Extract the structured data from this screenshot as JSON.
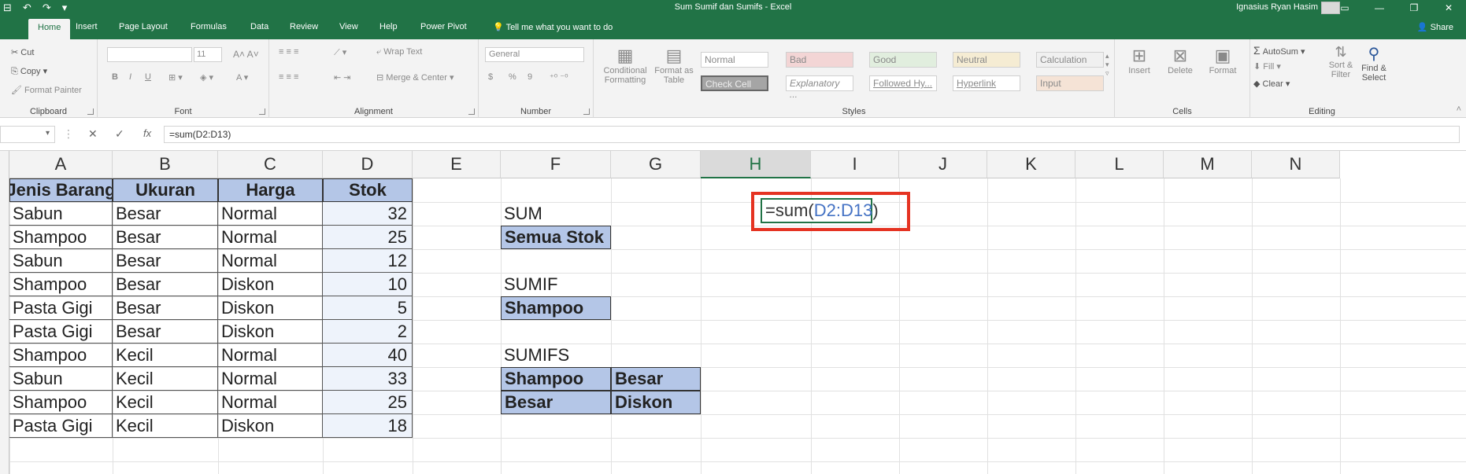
{
  "window": {
    "title": "Sum Sumif dan Sumifs  -  Excel",
    "user": "Ignasius Ryan Hasim",
    "controls": [
      "▭",
      "—",
      "❐",
      "✕"
    ]
  },
  "qat": {
    "save": "⊟",
    "undo": "↶",
    "redo": "↷",
    "more": "▾"
  },
  "tabs": [
    "Home",
    "Insert",
    "Page Layout",
    "Formulas",
    "Data",
    "Review",
    "View",
    "Help",
    "Power Pivot"
  ],
  "tell_me": "Tell me what you want to do",
  "share": "Share",
  "ribbon": {
    "clipboard": {
      "label": "Clipboard",
      "cut": "Cut",
      "copy": "Copy",
      "format_painter": "Format Painter"
    },
    "font": {
      "label": "Font",
      "size": "11",
      "bold": "B",
      "italic": "I",
      "underline": "U"
    },
    "alignment": {
      "label": "Alignment",
      "wrap_text": "Wrap Text",
      "merge_center": "Merge & Center"
    },
    "number": {
      "label": "Number",
      "format": "General",
      "currency": "$",
      "percent": "%",
      "comma": "9"
    },
    "styles": {
      "label": "Styles",
      "conditional": "Conditional",
      "conditional_sub": "Formatting",
      "format_as": "Format as",
      "format_as_sub": "Table",
      "gallery": [
        "Normal",
        "Bad",
        "Good",
        "Neutral",
        "Calculation",
        "Check Cell",
        "Explanatory ...",
        "Followed Hy...",
        "Hyperlink",
        "Input"
      ]
    },
    "cells": {
      "label": "Cells",
      "insert": "Insert",
      "delete": "Delete",
      "format": "Format"
    },
    "editing": {
      "label": "Editing",
      "autosum": "AutoSum",
      "fill": "Fill",
      "clear": "Clear",
      "sort": "Sort &",
      "sort_sub": "Filter",
      "find": "Find &",
      "find_sub": "Select"
    }
  },
  "formula_bar": {
    "cancel": "✕",
    "enter": "✓",
    "fx": "fx",
    "value": "=sum(D2:D13)"
  },
  "columns": [
    "A",
    "B",
    "C",
    "D",
    "E",
    "F",
    "G",
    "H",
    "I",
    "J",
    "K",
    "L",
    "M",
    "N"
  ],
  "active_column": "H",
  "table": {
    "headers": [
      "Jenis Barang",
      "Ukuran",
      "Harga",
      "Stok"
    ],
    "rows": [
      [
        "Sabun",
        "Besar",
        "Normal",
        "32"
      ],
      [
        "Shampoo",
        "Besar",
        "Normal",
        "25"
      ],
      [
        "Sabun",
        "Besar",
        "Normal",
        "12"
      ],
      [
        "Shampoo",
        "Besar",
        "Diskon",
        "10"
      ],
      [
        "Pasta Gigi",
        "Besar",
        "Diskon",
        "5"
      ],
      [
        "Pasta Gigi",
        "Besar",
        "Diskon",
        "2"
      ],
      [
        "Shampoo",
        "Kecil",
        "Normal",
        "40"
      ],
      [
        "Sabun",
        "Kecil",
        "Normal",
        "33"
      ],
      [
        "Shampoo",
        "Kecil",
        "Normal",
        "25"
      ],
      [
        "Pasta Gigi",
        "Kecil",
        "Diskon",
        "18"
      ]
    ]
  },
  "side": {
    "sum_label": "SUM",
    "sum_criteria": "Semua Stok",
    "sumif_label": "SUMIF",
    "sumif_criteria": "Shampoo",
    "sumifs_label": "SUMIFS",
    "sumifs_rows": [
      [
        "Shampoo",
        "Besar"
      ],
      [
        "Besar",
        "Diskon"
      ]
    ]
  },
  "edit_cell": {
    "prefix": "=sum(",
    "ref": "D2:D13",
    "suffix": ")"
  }
}
